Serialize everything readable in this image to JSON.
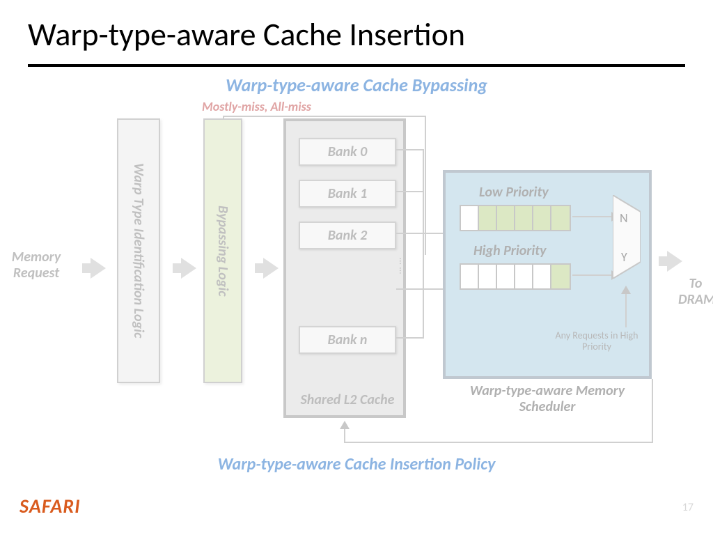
{
  "title": "Warp-type-aware Cache Insertion",
  "subtitle": "Warp-type-aware Cache Bypassing",
  "red_label": "Mostly-miss, All-miss",
  "mem_request": "Memory Request",
  "blocks": {
    "wtil": "Warp Type Identification Logic",
    "bypass": "Bypassing Logic"
  },
  "l2": {
    "banks": [
      "Bank 0",
      "Bank 1",
      "Bank 2",
      "Bank n"
    ],
    "dots": "……",
    "label": "Shared L2 Cache"
  },
  "scheduler": {
    "low": "Low Priority",
    "high": "High Priority",
    "mux": {
      "n": "N",
      "y": "Y"
    },
    "any": "Any Requests in High Priority",
    "label": "Warp-type-aware Memory Scheduler"
  },
  "to_dram": "To DRAM",
  "policy": "Warp-type-aware Cache Insertion Policy",
  "logo": "SAFARI",
  "page": "17"
}
